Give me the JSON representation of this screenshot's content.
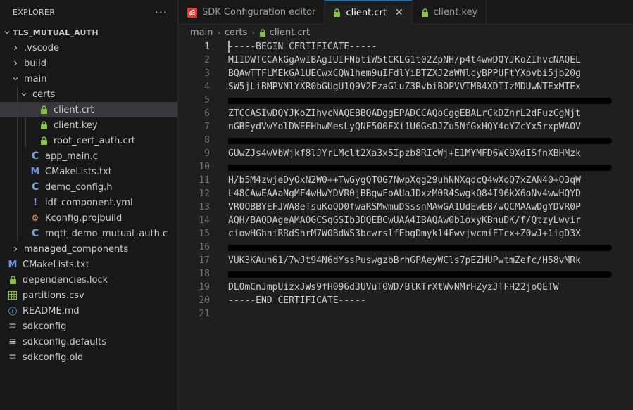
{
  "explorer": {
    "title": "EXPLORER",
    "more_label": "···"
  },
  "tree": [
    {
      "label": "TLS_MUTUAL_AUTH",
      "name": "folder-tls-mutual-auth",
      "depth": 0,
      "chevron": "down",
      "icon": "",
      "root": true
    },
    {
      "label": ".vscode",
      "name": "folder-vscode",
      "depth": 1,
      "chevron": "right",
      "icon": ""
    },
    {
      "label": "build",
      "name": "folder-build",
      "depth": 1,
      "chevron": "right",
      "icon": ""
    },
    {
      "label": "main",
      "name": "folder-main",
      "depth": 1,
      "chevron": "down",
      "icon": ""
    },
    {
      "label": "certs",
      "name": "folder-certs",
      "depth": 2,
      "chevron": "down",
      "icon": ""
    },
    {
      "label": "client.crt",
      "name": "file-client-crt",
      "depth": 3,
      "chevron": "",
      "icon": "lock",
      "active": true
    },
    {
      "label": "client.key",
      "name": "file-client-key",
      "depth": 3,
      "chevron": "",
      "icon": "lock"
    },
    {
      "label": "root_cert_auth.crt",
      "name": "file-root-cert-auth-crt",
      "depth": 3,
      "chevron": "",
      "icon": "lock"
    },
    {
      "label": "app_main.c",
      "name": "file-app-main-c",
      "depth": 2,
      "chevron": "",
      "icon": "c"
    },
    {
      "label": "CMakeLists.txt",
      "name": "file-main-cmakelists",
      "depth": 2,
      "chevron": "",
      "icon": "m"
    },
    {
      "label": "demo_config.h",
      "name": "file-demo-config-h",
      "depth": 2,
      "chevron": "",
      "icon": "c"
    },
    {
      "label": "idf_component.yml",
      "name": "file-idf-component-yml",
      "depth": 2,
      "chevron": "",
      "icon": "yml"
    },
    {
      "label": "Kconfig.projbuild",
      "name": "file-kconfig-projbuild",
      "depth": 2,
      "chevron": "",
      "icon": "k"
    },
    {
      "label": "mqtt_demo_mutual_auth.c",
      "name": "file-mqtt-demo-mutual-auth-c",
      "depth": 2,
      "chevron": "",
      "icon": "c"
    },
    {
      "label": "managed_components",
      "name": "folder-managed-components",
      "depth": 1,
      "chevron": "right",
      "icon": ""
    },
    {
      "label": "CMakeLists.txt",
      "name": "file-root-cmakelists",
      "depth": 1,
      "chevron": "",
      "icon": "m",
      "iconOnly": true
    },
    {
      "label": "dependencies.lock",
      "name": "file-dependencies-lock",
      "depth": 1,
      "chevron": "",
      "icon": "lock",
      "iconOnly": true
    },
    {
      "label": "partitions.csv",
      "name": "file-partitions-csv",
      "depth": 1,
      "chevron": "",
      "icon": "csv",
      "iconOnly": true
    },
    {
      "label": "README.md",
      "name": "file-readme-md",
      "depth": 1,
      "chevron": "",
      "icon": "md",
      "iconOnly": true
    },
    {
      "label": "sdkconfig",
      "name": "file-sdkconfig",
      "depth": 1,
      "chevron": "",
      "icon": "eq",
      "iconOnly": true
    },
    {
      "label": "sdkconfig.defaults",
      "name": "file-sdkconfig-defaults",
      "depth": 1,
      "chevron": "",
      "icon": "eq",
      "iconOnly": true
    },
    {
      "label": "sdkconfig.old",
      "name": "file-sdkconfig-old",
      "depth": 1,
      "chevron": "",
      "icon": "eq",
      "iconOnly": true
    }
  ],
  "tabs": [
    {
      "label": "SDK Configuration editor",
      "name": "tab-sdk-configuration-editor",
      "icon": "espressif"
    },
    {
      "label": "client.crt",
      "name": "tab-client-crt",
      "icon": "lock",
      "active": true,
      "close": "✕"
    },
    {
      "label": "client.key",
      "name": "tab-client-key",
      "icon": "lock"
    }
  ],
  "breadcrumb": [
    "main",
    "certs",
    "client.crt"
  ],
  "colors": {
    "lock_green": "#8bc34a",
    "accent": "#0078d4",
    "espressif_red": "#e7352c"
  },
  "current_line": 1,
  "lines": [
    {
      "n": "1",
      "text": "-----BEGIN CERTIFICATE-----"
    },
    {
      "n": "2",
      "text": "MIIDWTCCAkGgAwIBAgIUIFNbtiW5tCKLG1t02ZpNH/p4t4wwDQYJKoZIhvcNAQEL"
    },
    {
      "n": "3",
      "text": "BQAwTTFLMEkGA1UECwxCQW1hem9uIFdlYiBTZXJ2aWNlcyBPPUFtYXpvbi5jb20g"
    },
    {
      "n": "4",
      "text": "SW5jLiBMPVNlYXR0bGUgU1Q9V2FzaGluZ3RvbiBDPVVTMB4XDTIzMDUwNTExMTEx"
    },
    {
      "n": "5",
      "text": "",
      "redacted": true
    },
    {
      "n": "6",
      "text": "ZTCCASIwDQYJKoZIhvcNAQEBBQADggEPADCCAQoCggEBALrCkDZnrL2dFuzCgNjt"
    },
    {
      "n": "7",
      "text": "nGBEydVwYolDWEEHhwMesLyQNF500FXi1U6GsDJZu5NfGxHQY4oYZcYx5rxpWAOV"
    },
    {
      "n": "8",
      "text": "",
      "redacted": true
    },
    {
      "n": "9",
      "text": "GUwZJs4wVbWjkf8lJYrLMclt2Xa3x5Ipzb8RIcWj+E1MYMFD6WC9XdISfnXBHMzk"
    },
    {
      "n": "10",
      "text": "",
      "redacted": true
    },
    {
      "n": "11",
      "text": "H/b5M4zwjeDyOxN2W0++TwGygQT0G7NwpXqg29uhNNXqdcQ4wXoQ7xZAN40+O3qW"
    },
    {
      "n": "12",
      "text": "L48CAwEAAaNgMF4wHwYDVR0jBBgwFoAUaJDxzM0R4SwgkQ84I96kX6oNv4wwHQYD"
    },
    {
      "n": "13",
      "text": "VR0OBBYEFJWA8eTsuKoQD0fwaRSMwmuDSssnMAwGA1UdEwEB/wQCMAAwDgYDVR0P"
    },
    {
      "n": "14",
      "text": "AQH/BAQDAgeAMA0GCSqGSIb3DQEBCwUAA4IBAQAw0b1oxyKBnuDK/f/QtzyLwvir"
    },
    {
      "n": "15",
      "text": "ciowHGhniRRdShrM7W0BdWS3bcwrslfEbgDmyk14FwvjwcmiFTcx+Z0wJ+1igD3X"
    },
    {
      "n": "16",
      "text": "",
      "redacted": true
    },
    {
      "n": "17",
      "text": "VUK3KAun61/7wJt94N6dYssPuswgzbBrhGPAeyWCls7pEZHUPwtmZefc/H58vMRk"
    },
    {
      "n": "18",
      "text": "",
      "redacted": true
    },
    {
      "n": "19",
      "text": "DL0mCnJmpUizxJWs9fH096d3UVuT0WD/BlKTrXtWvNMrHZyzJTFH22joQETW"
    },
    {
      "n": "20",
      "text": "-----END CERTIFICATE-----"
    },
    {
      "n": "21",
      "text": ""
    }
  ]
}
